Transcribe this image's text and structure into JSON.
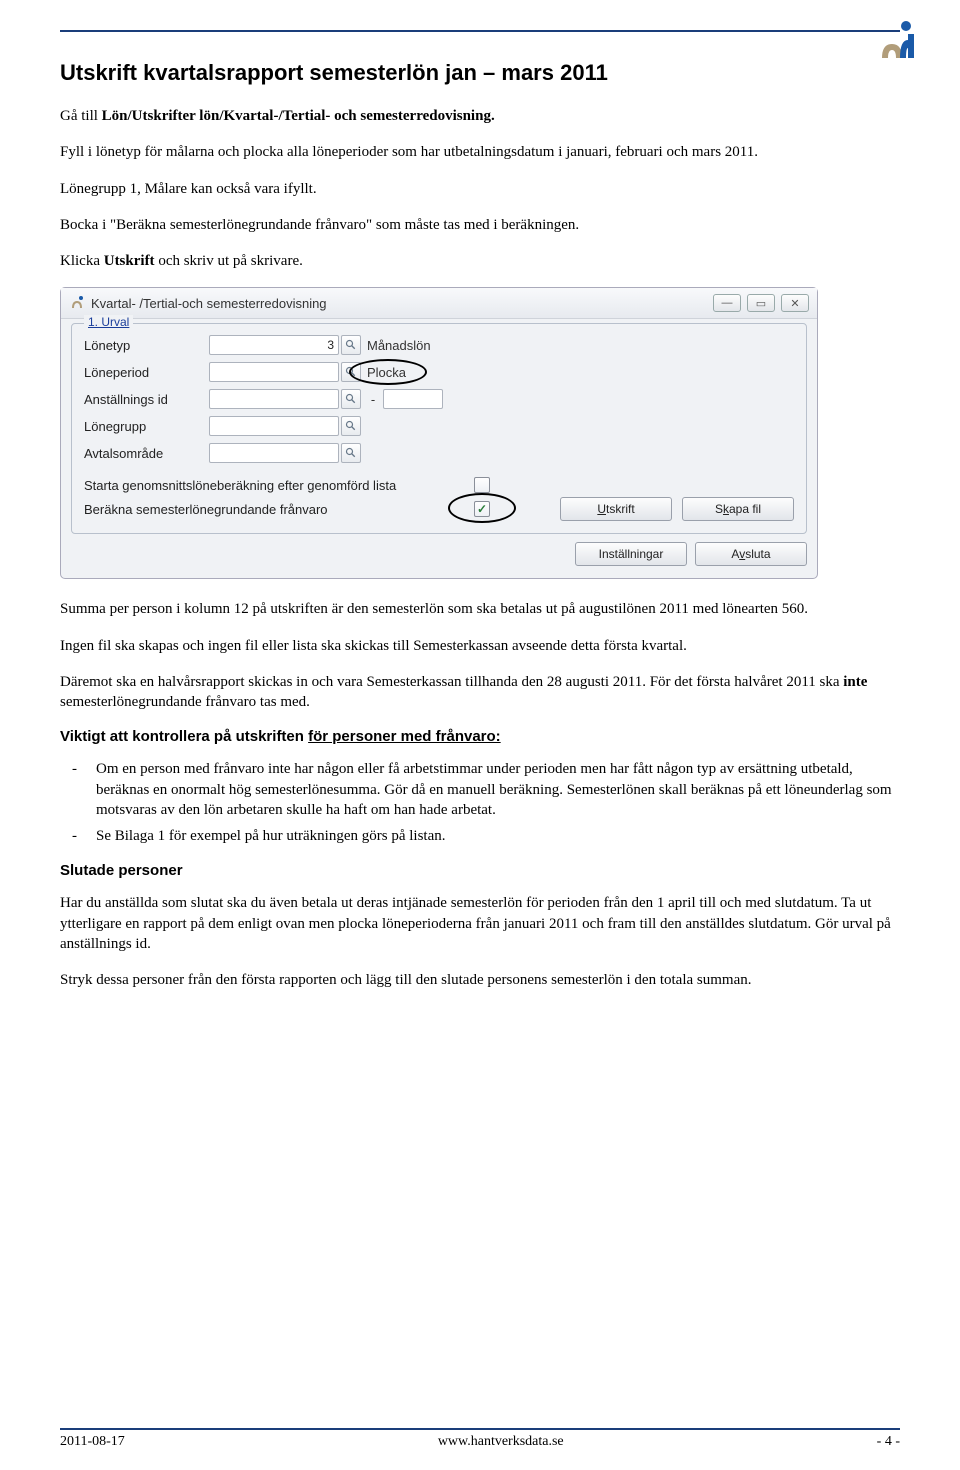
{
  "header": {
    "logo_alt": "logo"
  },
  "title": "Utskrift kvartalsrapport semesterlön jan – mars 2011",
  "p1_a": "Gå till ",
  "p1_b": "Lön/Utskrifter lön/Kvartal-/Tertial- och semesterredovisning.",
  "p2": "Fyll i lönetyp för målarna och plocka alla löneperioder som har utbetalningsdatum i januari, februari och mars 2011.",
  "p3": "Lönegrupp 1, Målare kan också vara ifyllt.",
  "p4": "Bocka i \"Beräkna semesterlönegrundande frånvaro\" som måste tas med i beräkningen.",
  "p5_a": "Klicka ",
  "p5_b": "Utskrift",
  "p5_c": " och skriv ut på skrivare.",
  "dialog": {
    "title": "Kvartal- /Tertial-och semesterredovisning",
    "legend": "1. Urval",
    "labels": {
      "lonetyp": "Lönetyp",
      "loneperiod": "Löneperiod",
      "anstallningsid": "Anställnings id",
      "lonegrupp": "Lönegrupp",
      "avtalsomrade": "Avtalsområde"
    },
    "values": {
      "lonetyp": "3",
      "lonetyp_after": "Månadslön",
      "loneperiod_after": "Plocka",
      "anstallningsid_sep": "-"
    },
    "checks": {
      "starta": "Starta genomsnittslöneberäkning efter genomförd lista",
      "berakna": "Beräkna semesterlönegrundande frånvaro"
    },
    "buttons": {
      "utskrift_u": "U",
      "utskrift_rest": "tskrift",
      "skapafil_s": "S",
      "skapafil_u": "k",
      "skapafil_rest": "apa fil",
      "installningar": "Inställningar",
      "avsluta_a": "A",
      "avsluta_u": "v",
      "avsluta_rest": "sluta"
    }
  },
  "p6": "Summa per person i kolumn 12 på utskriften är den semesterlön som ska betalas ut på augustilönen 2011 med lönearten 560.",
  "p7": "Ingen fil ska skapas och ingen fil eller lista ska skickas till Semesterkassan avseende detta första kvartal.",
  "p8_a": "Däremot ska en halvårsrapport skickas in och vara Semesterkassan tillhanda den 28 augusti 2011. För det första halvåret 2011 ska ",
  "p8_b": "inte",
  "p8_c": " semesterlönegrundande frånvaro tas med.",
  "h3_a": "Viktigt att kontrollera på utskriften ",
  "h3_b": "för personer med frånvaro:",
  "b1": "Om en person med frånvaro inte har någon eller få arbetstimmar under perioden men har fått någon typ av ersättning utbetald, beräknas en onormalt hög semesterlönesumma. Gör då en manuell beräkning. Semesterlönen skall beräknas på ett löneunderlag som motsvaras av den lön arbetaren skulle ha haft om han hade arbetat.",
  "b2": "Se Bilaga 1 för exempel på hur uträkningen görs på listan.",
  "h4": "Slutade personer",
  "p9": "Har du anställda som slutat ska du även betala ut deras intjänade semesterlön för perioden från den 1 april till och med slutdatum. Ta ut ytterligare en rapport på dem enligt ovan men plocka löneperioderna från januari 2011 och fram till den anställdes slutdatum. Gör urval på anställnings id.",
  "p10": "Stryk dessa personer från den första rapporten och lägg till den slutade personens semesterlön i den totala summan.",
  "footer": {
    "date": "2011-08-17",
    "url": "www.hantverksdata.se",
    "page": "- 4 -"
  }
}
